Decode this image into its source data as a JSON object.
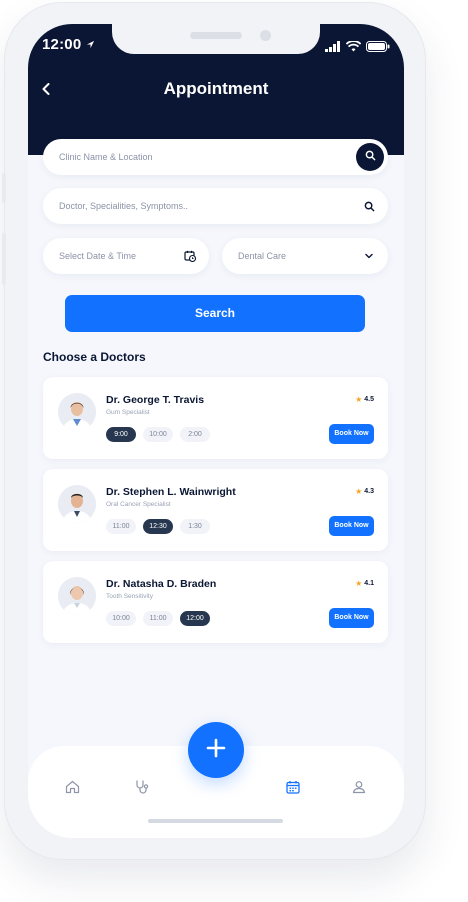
{
  "status": {
    "time": "12:00"
  },
  "header": {
    "title": "Appointment"
  },
  "search": {
    "clinic_placeholder": "Clinic Name & Location",
    "doctor_placeholder": "Doctor, Specialities, Symptoms..",
    "date_placeholder": "Select Date & Time",
    "care_value": "Dental Care",
    "button_label": "Search"
  },
  "section_title": "Choose a Doctors",
  "doctors": [
    {
      "name": "Dr. George T. Travis",
      "specialty": "Gum Specialist",
      "rating": "4.5",
      "slots": [
        "9:00",
        "10:00",
        "2:00"
      ],
      "selected": 0,
      "book_label": "Book Now"
    },
    {
      "name": "Dr. Stephen L. Wainwright",
      "specialty": "Oral Cancer Specialist",
      "rating": "4.3",
      "slots": [
        "11:00",
        "12:30",
        "1:30"
      ],
      "selected": 1,
      "book_label": "Book Now"
    },
    {
      "name": "Dr. Natasha D. Braden",
      "specialty": "Tooth Sensitivity",
      "rating": "4.1",
      "slots": [
        "10:00",
        "11:00",
        "12:00"
      ],
      "selected": 2,
      "book_label": "Book Now"
    }
  ],
  "nav": {
    "items": [
      "home-icon",
      "stethoscope-icon",
      "calendar-icon",
      "profile-icon"
    ],
    "active": "calendar-icon"
  },
  "colors": {
    "primary": "#1272ff",
    "header": "#0a1633",
    "background": "#f5f7fc",
    "star": "#f5a623"
  }
}
